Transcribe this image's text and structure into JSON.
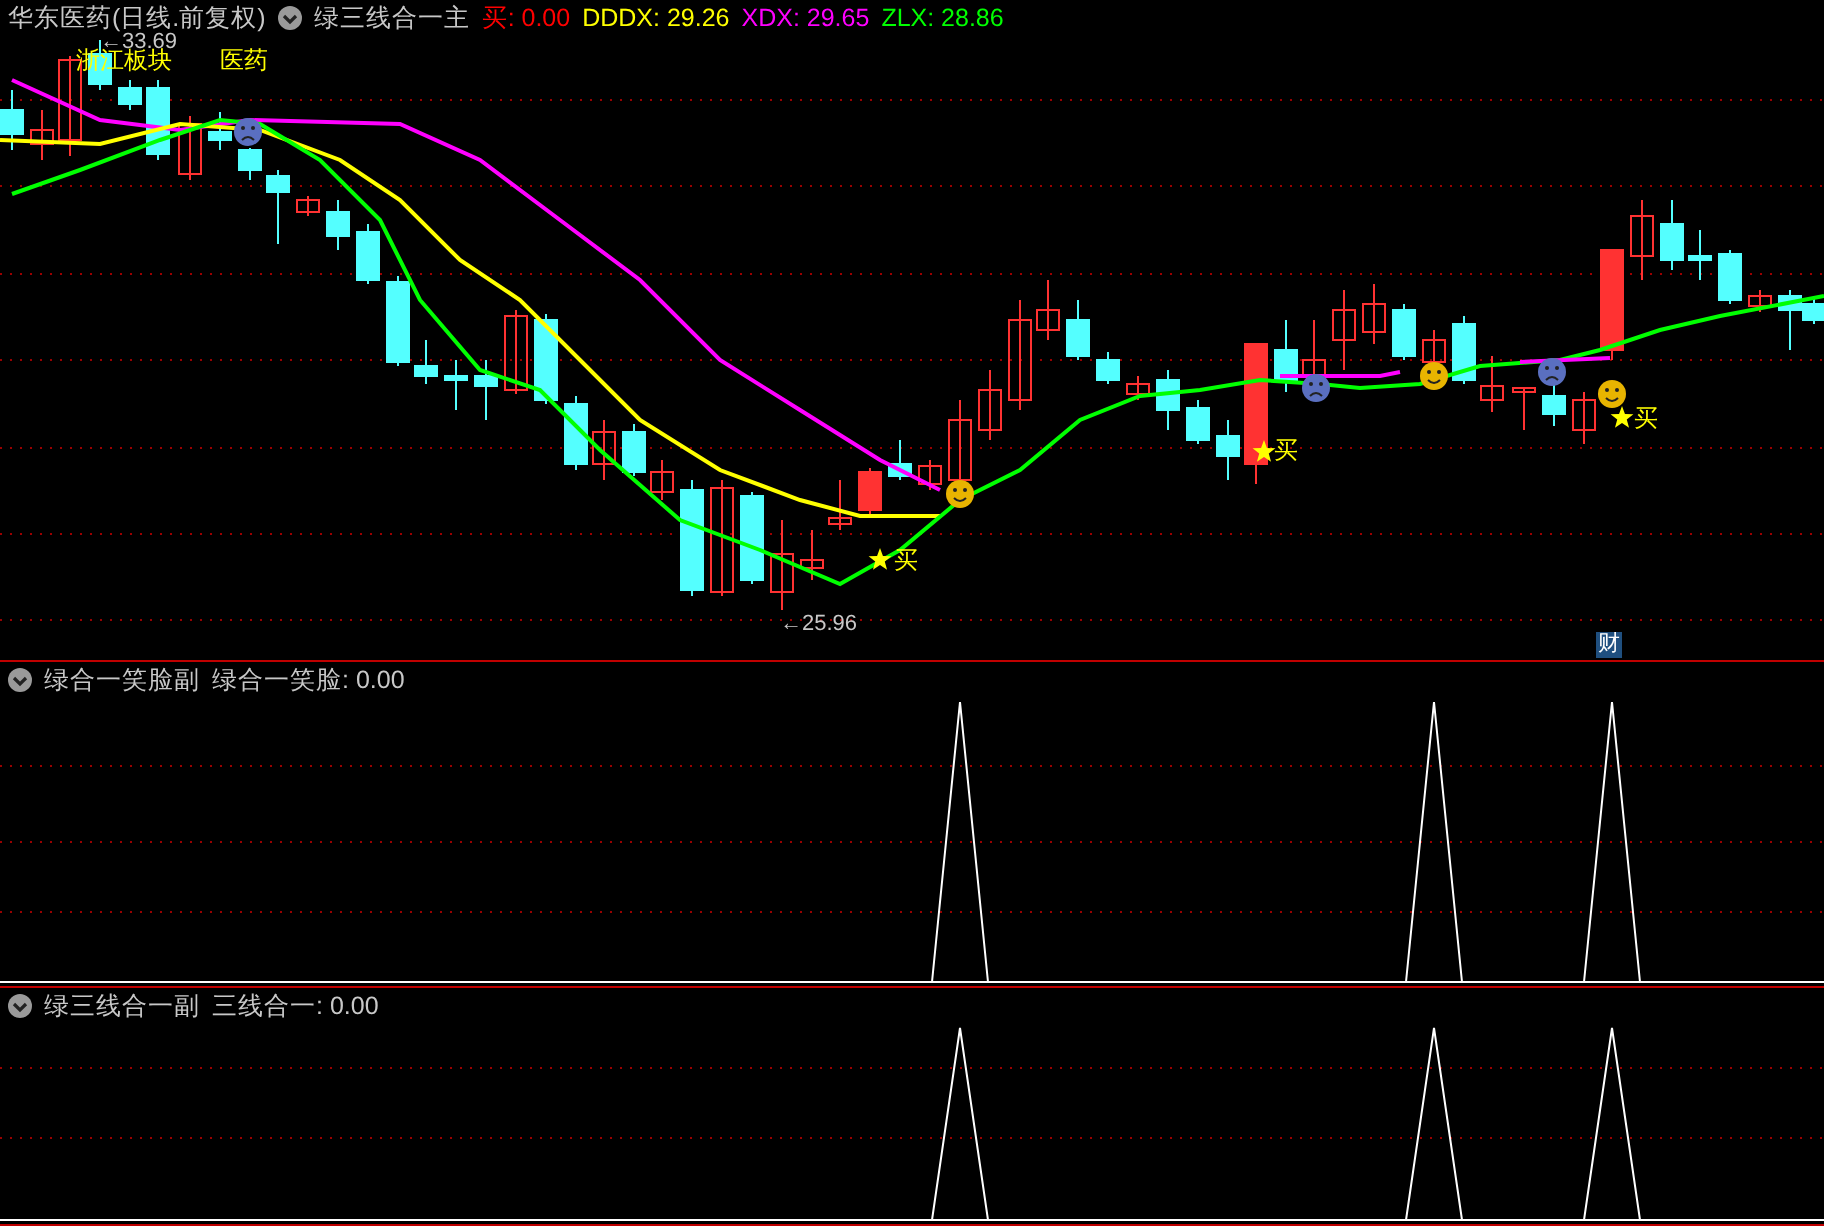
{
  "header": {
    "stock": "华东医药(日线.前复权)",
    "indicator": "绿三线合一主"
  },
  "readouts": [
    {
      "text": "买: 0.00",
      "color": "#ff0000"
    },
    {
      "text": "DDDX: 29.26",
      "color": "#ffff00"
    },
    {
      "text": "XDX: 29.65",
      "color": "#ff00ff"
    },
    {
      "text": "ZLX: 28.86",
      "color": "#00ff00"
    }
  ],
  "annotations": [
    {
      "kind": "price",
      "text": "←33.69"
    },
    {
      "kind": "sector",
      "text": "浙江板块"
    },
    {
      "kind": "sector",
      "text": "医药"
    },
    {
      "kind": "signal",
      "text": "买"
    },
    {
      "kind": "price",
      "text": "←25.96"
    },
    {
      "kind": "signal",
      "text": "买"
    },
    {
      "kind": "signal",
      "text": "买"
    },
    {
      "kind": "badge",
      "text": "财"
    }
  ],
  "panels": [
    {
      "name": "绿合一笑脸副",
      "readout": "绿合一笑脸: 0.00"
    },
    {
      "name": "绿三线合一副",
      "readout": "三线合一: 0.00"
    }
  ]
}
